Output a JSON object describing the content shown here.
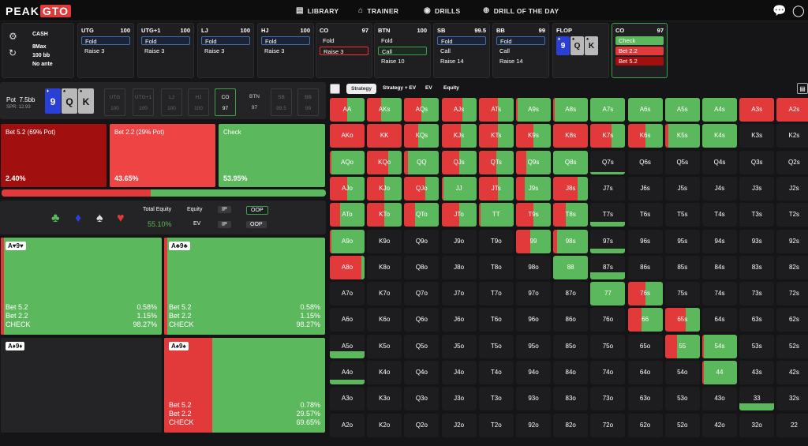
{
  "brand": {
    "peak": "PEAK",
    "gto": "GTO"
  },
  "nav": [
    {
      "icon": "library-icon",
      "label": "LIBRARY"
    },
    {
      "icon": "trainer-icon",
      "label": "TRAINER"
    },
    {
      "icon": "drills-icon",
      "label": "DRILLS"
    },
    {
      "icon": "drill-of-day-icon",
      "label": "DRILL OF THE DAY"
    }
  ],
  "game": {
    "type": "CASH",
    "max": "8Max",
    "stack": "100 bb",
    "ante": "No ante"
  },
  "positions": [
    {
      "name": "UTG",
      "stack": "100",
      "actions": [
        {
          "label": "Fold",
          "style": "fold"
        },
        {
          "label": "Raise 3",
          "style": "raise"
        }
      ]
    },
    {
      "name": "UTG+1",
      "stack": "100",
      "actions": [
        {
          "label": "Fold",
          "style": "fold"
        },
        {
          "label": "Raise 3",
          "style": "raise"
        }
      ]
    },
    {
      "name": "LJ",
      "stack": "100",
      "actions": [
        {
          "label": "Fold",
          "style": "fold"
        },
        {
          "label": "Raise 3",
          "style": "raise"
        }
      ]
    },
    {
      "name": "HJ",
      "stack": "100",
      "actions": [
        {
          "label": "Fold",
          "style": "fold"
        },
        {
          "label": "Raise 3",
          "style": "raise"
        }
      ]
    },
    {
      "name": "CO",
      "stack": "97",
      "actions": [
        {
          "label": "Fold",
          "style": "raise"
        },
        {
          "label": "Raise 3",
          "style": "redb"
        }
      ]
    },
    {
      "name": "BTN",
      "stack": "100",
      "actions": [
        {
          "label": "Fold",
          "style": "raise"
        },
        {
          "label": "Call",
          "style": "call"
        },
        {
          "label": "Raise 10",
          "style": "raise"
        }
      ]
    },
    {
      "name": "SB",
      "stack": "99.5",
      "actions": [
        {
          "label": "Fold",
          "style": "fold"
        },
        {
          "label": "Call",
          "style": "raise"
        },
        {
          "label": "Raise 14",
          "style": "raise"
        }
      ]
    },
    {
      "name": "BB",
      "stack": "99",
      "actions": [
        {
          "label": "Fold",
          "style": "fold"
        },
        {
          "label": "Call",
          "style": "raise"
        },
        {
          "label": "Raise 14",
          "style": "raise"
        }
      ]
    }
  ],
  "flop": {
    "label": "FLOP",
    "cards": [
      "9",
      "Q",
      "K"
    ]
  },
  "co_action": {
    "name": "CO",
    "stack": "97",
    "actions": [
      {
        "label": "Check",
        "style": "green"
      },
      {
        "label": "Bet 2.2",
        "style": "red"
      },
      {
        "label": "Bet 5.2",
        "style": "dred"
      }
    ]
  },
  "pot": {
    "label": "Pot",
    "value": "7.5bb",
    "spr": "SPR: 12.93"
  },
  "board": [
    "9",
    "Q",
    "K"
  ],
  "seats": [
    {
      "name": "UTG",
      "val": "100"
    },
    {
      "name": "UTG+1",
      "val": "100"
    },
    {
      "name": "LJ",
      "val": "100"
    },
    {
      "name": "HJ",
      "val": "100"
    },
    {
      "name": "CO",
      "val": "97"
    },
    {
      "name": "BTN",
      "val": "97"
    },
    {
      "name": "SB",
      "val": "99.5"
    },
    {
      "name": "BB",
      "val": "99"
    }
  ],
  "strategy": [
    {
      "label": "Bet 5.2 (69% Pot)",
      "pct": "2.40%",
      "color": "#a10f0f"
    },
    {
      "label": "Bet 2.2 (29% Pot)",
      "pct": "43.65%",
      "color": "#ef4444"
    },
    {
      "label": "Check",
      "pct": "53.95%",
      "color": "#5cb85c"
    }
  ],
  "strategy_bar": {
    "red_fraction": 0.46
  },
  "equity": {
    "title": "Total Equity",
    "value": "55.10%",
    "equity_label": "Equity",
    "ev_label": "EV",
    "ip": "IP",
    "oop": "OOP"
  },
  "hands": [
    {
      "combo": "A♥9♥",
      "lines": [
        [
          "Bet 5.2",
          "0.58%"
        ],
        [
          "Bet 2.2",
          "1.15%"
        ],
        [
          "CHECK",
          "98.27%"
        ]
      ],
      "red": 0.02
    },
    {
      "combo": "A♣9♣",
      "lines": [
        [
          "Bet 5.2",
          "0.58%"
        ],
        [
          "Bet 2.2",
          "1.15%"
        ],
        [
          "CHECK",
          "98.27%"
        ]
      ],
      "red": 0.02
    },
    {
      "combo": "A♦9♦",
      "lines": [],
      "red": 0
    },
    {
      "combo": "A♠9♠",
      "lines": [
        [
          "Bet 5.2",
          "0.78%"
        ],
        [
          "Bet 2.2",
          "29.57%"
        ],
        [
          "CHECK",
          "69.65%"
        ]
      ],
      "red": 0.3
    }
  ],
  "grid_tabs": [
    "Strategy",
    "Strategy + EV",
    "EV",
    "Equity"
  ],
  "grid": [
    [
      "AA",
      "AKs",
      "AQs",
      "AJs",
      "ATs",
      "A9s",
      "A8s",
      "A7s",
      "A6s",
      "A5s",
      "A4s",
      "A3s",
      "A2s"
    ],
    [
      "AKo",
      "KK",
      "KQs",
      "KJs",
      "KTs",
      "K9s",
      "K8s",
      "K7s",
      "K6s",
      "K5s",
      "K4s",
      "K3s",
      "K2s"
    ],
    [
      "AQo",
      "KQo",
      "QQ",
      "QJs",
      "QTs",
      "Q9s",
      "Q8s",
      "Q7s",
      "Q6s",
      "Q5s",
      "Q4s",
      "Q3s",
      "Q2s"
    ],
    [
      "AJo",
      "KJo",
      "QJo",
      "JJ",
      "JTs",
      "J9s",
      "J8s",
      "J7s",
      "J6s",
      "J5s",
      "J4s",
      "J3s",
      "J2s"
    ],
    [
      "ATo",
      "KTo",
      "QTo",
      "JTo",
      "TT",
      "T9s",
      "T8s",
      "T7s",
      "T6s",
      "T5s",
      "T4s",
      "T3s",
      "T2s"
    ],
    [
      "A9o",
      "K9o",
      "Q9o",
      "J9o",
      "T9o",
      "99",
      "98s",
      "97s",
      "96s",
      "95s",
      "94s",
      "93s",
      "92s"
    ],
    [
      "A8o",
      "K8o",
      "Q8o",
      "J8o",
      "T8o",
      "98o",
      "88",
      "87s",
      "86s",
      "85s",
      "84s",
      "83s",
      "82s"
    ],
    [
      "A7o",
      "K7o",
      "Q7o",
      "J7o",
      "T7o",
      "97o",
      "87o",
      "77",
      "76s",
      "75s",
      "74s",
      "73s",
      "72s"
    ],
    [
      "A6o",
      "K6o",
      "Q6o",
      "J6o",
      "T6o",
      "96o",
      "86o",
      "76o",
      "66",
      "65s",
      "64s",
      "63s",
      "62s"
    ],
    [
      "A5o",
      "K5o",
      "Q5o",
      "J5o",
      "T5o",
      "95o",
      "85o",
      "75o",
      "65o",
      "55",
      "54s",
      "53s",
      "52s"
    ],
    [
      "A4o",
      "K4o",
      "Q4o",
      "J4o",
      "T4o",
      "94o",
      "84o",
      "74o",
      "64o",
      "54o",
      "44",
      "43s",
      "42s"
    ],
    [
      "A3o",
      "K3o",
      "Q3o",
      "J3o",
      "T3o",
      "93o",
      "83o",
      "73o",
      "63o",
      "53o",
      "43o",
      "33",
      "32s"
    ],
    [
      "A2o",
      "K2o",
      "Q2o",
      "J2o",
      "T2o",
      "92o",
      "82o",
      "72o",
      "62o",
      "52o",
      "42o",
      "32o",
      "22"
    ]
  ]
}
